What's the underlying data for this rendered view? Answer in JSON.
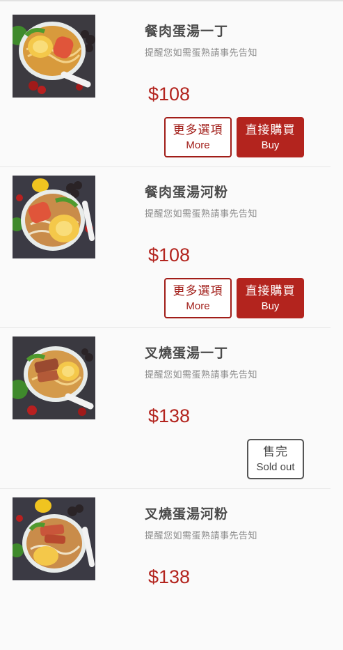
{
  "colors": {
    "accent": "#b3241e",
    "accent_dark": "#a11d18",
    "text_dark": "#4a4a4a",
    "text_muted": "#8a8a8a",
    "background": "#fafafa"
  },
  "products": [
    {
      "name": "餐肉蛋湯一丁",
      "note": "提醒您如需蛋熟請事先告知",
      "price": "$108",
      "more_label": "更多選項",
      "more_sub": "More",
      "buy_label": "直接購買",
      "buy_sub": "Buy",
      "image_icon": "noodle-bowl-spam-egg-icon"
    },
    {
      "name": "餐肉蛋湯河粉",
      "note": "提醒您如需蛋熟請事先告知",
      "price": "$108",
      "more_label": "更多選項",
      "more_sub": "More",
      "buy_label": "直接購買",
      "buy_sub": "Buy",
      "image_icon": "rice-noodle-bowl-spam-egg-icon"
    },
    {
      "name": "叉燒蛋湯一丁",
      "note": "提醒您如需蛋熟請事先告知",
      "price": "$138",
      "soldout_label": "售完",
      "soldout_sub": "Sold out",
      "image_icon": "noodle-bowl-charsiu-egg-icon"
    },
    {
      "name": "叉燒蛋湯河粉",
      "note": "提醒您如需蛋熟請事先告知",
      "price": "$138",
      "image_icon": "rice-noodle-bowl-charsiu-egg-icon"
    }
  ]
}
